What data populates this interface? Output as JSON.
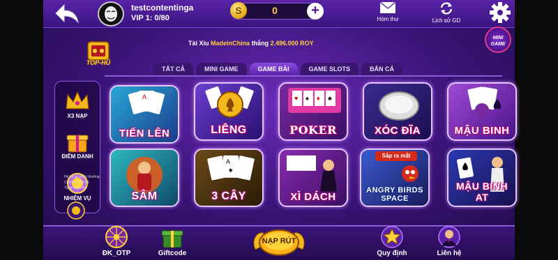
{
  "header": {
    "username": "testcontentinga",
    "vip_label": "VIP 1: 0/80",
    "coin_symbol": "S",
    "balance": "0",
    "plus_label": "+",
    "actions": [
      {
        "label": "Hòm thư",
        "icon": "mail-icon"
      },
      {
        "label": "Lịch sử GD",
        "icon": "history-icon"
      }
    ]
  },
  "brand": {
    "logo_text": "TOP-HŨ"
  },
  "ticker": {
    "prefix": "Tài Xỉu",
    "player": "MadeinChina",
    "verb": "thắng",
    "amount": "2.496.000 ROY"
  },
  "minigame": {
    "line1": "MINI",
    "line2": "GAME"
  },
  "tabs": [
    {
      "label": "TẤT CẢ",
      "active": false
    },
    {
      "label": "MINI GAME",
      "active": false
    },
    {
      "label": "GAME BÀI",
      "active": true
    },
    {
      "label": "GAME SLOTS",
      "active": false
    },
    {
      "label": "BẮN CÁ",
      "active": false
    }
  ],
  "sidebar": {
    "items": [
      {
        "label": "X3 NẠP",
        "icon": "crown-icon"
      },
      {
        "label": "ĐIỂM DANH",
        "icon": "gift-box-icon"
      },
      {
        "label": "NHIỆM VỤ",
        "icon": "mission-medal-icon"
      }
    ]
  },
  "games": [
    {
      "label": "TIẾN LÊN",
      "art": "cards-table-art"
    },
    {
      "label": "LIÊNG",
      "art": "gold-chip-art"
    },
    {
      "label": "POKER",
      "art": "poker-cards-art"
    },
    {
      "label": "XÓC ĐĨA",
      "art": "dice-plate-art"
    },
    {
      "label": "MẬU BINH",
      "art": "spade-cards-art"
    },
    {
      "label": "SÂM",
      "art": "warrior-art"
    },
    {
      "label": "3 CÂY",
      "art": "three-aces-art"
    },
    {
      "label": "XÌ DÁCH",
      "art": "lady-cards-art"
    },
    {
      "label": "ANGRY BIRDS SPACE",
      "badge": "Sắp ra mắt",
      "art": "angry-birds-art"
    },
    {
      "label": "MẬU BINH AT",
      "art": "lady-spade-art"
    }
  ],
  "chat": {
    "lines": [
      "Hệ hả ae nhận thưởng",
      "Chơi thế thôi hả",
      "Tặng đmm đm"
    ]
  },
  "bottom": {
    "left": [
      {
        "label": "ĐK_OTP",
        "icon": "wheel-icon"
      },
      {
        "label": "Giftcode",
        "icon": "giftcode-box-icon"
      }
    ],
    "center": {
      "label": "NẠP RÚT"
    },
    "right": [
      {
        "label": "Quy định",
        "icon": "star-icon"
      },
      {
        "label": "Liên hệ",
        "icon": "support-agent-icon"
      }
    ]
  },
  "colors": {
    "bg_primary": "#3b1478",
    "accent_gold": "#ffd23a",
    "label_pink": "#d4178a",
    "border_lilac": "#8a5cd6"
  }
}
